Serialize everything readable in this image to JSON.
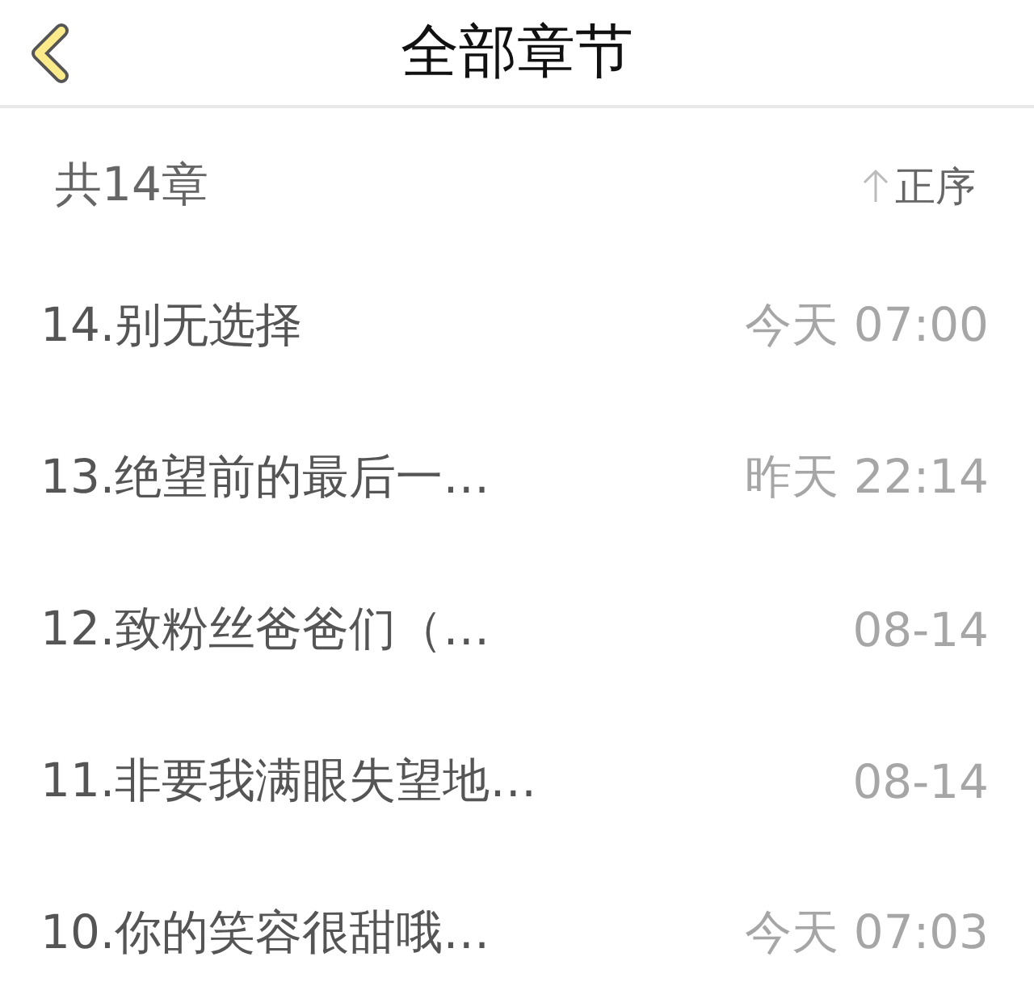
{
  "header": {
    "title": "全部章节"
  },
  "summary": {
    "count": "共14章",
    "sort_label": "正序"
  },
  "chapters": [
    {
      "title": "14.别无选择",
      "time": "今天 07:00"
    },
    {
      "title": "13.绝望前的最后一…",
      "time": "昨天 22:14"
    },
    {
      "title": "12.致粉丝爸爸们（…",
      "time": "08-14"
    },
    {
      "title": "11.非要我满眼失望地…",
      "time": "08-14"
    },
    {
      "title": "10.你的笑容很甜哦…",
      "time": "今天 07:03"
    }
  ]
}
